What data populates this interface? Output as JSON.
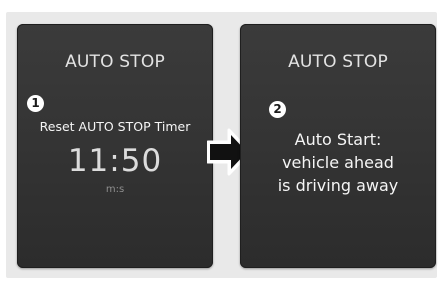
{
  "left_screen": {
    "title": "AUTO STOP",
    "step_number": "1",
    "timer_label": "Reset AUTO STOP Timer",
    "timer_value": "11:50",
    "timer_unit": "m:s"
  },
  "right_screen": {
    "title": "AUTO STOP",
    "step_number": "2",
    "message_lines": [
      "Auto Start:",
      "vehicle ahead",
      "is driving away"
    ]
  },
  "arrow_icon": "right-arrow-icon",
  "colors": {
    "screen_background": "#333333",
    "frame_background": "#e9e9e9",
    "text": "#f2f2f2",
    "arrow_fill": "#111111"
  }
}
